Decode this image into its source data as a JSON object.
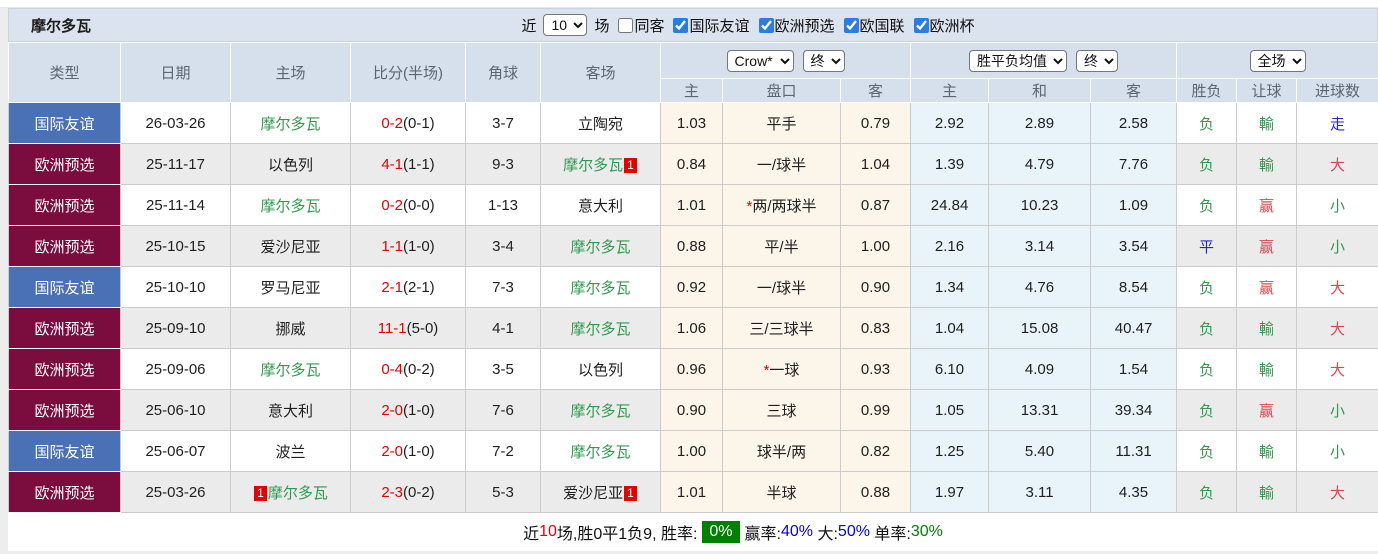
{
  "header": {
    "team": "摩尔多瓦",
    "recent_label": "近",
    "recent_value": "10",
    "matches_label": "场",
    "same_venue": {
      "label": "同客",
      "checked": false
    },
    "filters": [
      {
        "label": "国际友谊",
        "checked": true
      },
      {
        "label": "欧洲预选",
        "checked": true
      },
      {
        "label": "欧国联",
        "checked": true
      },
      {
        "label": "欧洲杯",
        "checked": true
      }
    ]
  },
  "selects": {
    "bookmaker": "Crow*",
    "odds_time": "终",
    "avg_type": "胜平负均值",
    "avg_time": "终",
    "scope": "全场"
  },
  "columns": {
    "left": [
      "类型",
      "日期",
      "主场",
      "比分(半场)",
      "角球",
      "客场"
    ],
    "sub": [
      "主",
      "盘口",
      "客",
      "主",
      "和",
      "客",
      "胜负",
      "让球",
      "进球数"
    ]
  },
  "colors": {
    "friendly_badge": "#4a71b6",
    "qualifier_badge": "#7b0c3e",
    "team_green": "#2f9a4f",
    "score_red": "#e60000",
    "result_red": "#d9474f",
    "result_blue": "#2626d9",
    "rate_badge_bg": "#008000",
    "value_blue": "#0000ee"
  },
  "rows": [
    {
      "type": "国际友谊",
      "type_key": "friendly",
      "date": "26-03-26",
      "home": {
        "name": "摩尔多瓦",
        "green": true,
        "badge_before": "",
        "badge_after": ""
      },
      "score": {
        "ft": "0-2",
        "ht": "(0-1)"
      },
      "corners": "3-7",
      "away": {
        "name": "立陶宛",
        "green": false,
        "badge_before": "",
        "badge_after": ""
      },
      "odds": {
        "home": "1.03",
        "star": false,
        "line": "平手",
        "away": "0.79"
      },
      "avg": {
        "home": "2.92",
        "draw": "2.89",
        "away": "2.58"
      },
      "result": {
        "text": "负",
        "color": "green"
      },
      "handicap": {
        "text": "輸",
        "color": "green"
      },
      "goals": {
        "text": "走",
        "color": "blue"
      }
    },
    {
      "type": "欧洲预选",
      "type_key": "qualifier",
      "date": "25-11-17",
      "home": {
        "name": "以色列",
        "green": false,
        "badge_before": "",
        "badge_after": ""
      },
      "score": {
        "ft": "4-1",
        "ht": "(1-1)"
      },
      "corners": "9-3",
      "away": {
        "name": "摩尔多瓦",
        "green": true,
        "badge_before": "",
        "badge_after": "1"
      },
      "odds": {
        "home": "0.84",
        "star": false,
        "line": "一/球半",
        "away": "1.04"
      },
      "avg": {
        "home": "1.39",
        "draw": "4.79",
        "away": "7.76"
      },
      "result": {
        "text": "负",
        "color": "green"
      },
      "handicap": {
        "text": "輸",
        "color": "green"
      },
      "goals": {
        "text": "大",
        "color": "red"
      }
    },
    {
      "type": "欧洲预选",
      "type_key": "qualifier",
      "date": "25-11-14",
      "home": {
        "name": "摩尔多瓦",
        "green": true,
        "badge_before": "",
        "badge_after": ""
      },
      "score": {
        "ft": "0-2",
        "ht": "(0-0)"
      },
      "corners": "1-13",
      "away": {
        "name": "意大利",
        "green": false,
        "badge_before": "",
        "badge_after": ""
      },
      "odds": {
        "home": "1.01",
        "star": true,
        "line": "两/两球半",
        "away": "0.87"
      },
      "avg": {
        "home": "24.84",
        "draw": "10.23",
        "away": "1.09"
      },
      "result": {
        "text": "负",
        "color": "green"
      },
      "handicap": {
        "text": "赢",
        "color": "red"
      },
      "goals": {
        "text": "小",
        "color": "green"
      }
    },
    {
      "type": "欧洲预选",
      "type_key": "qualifier",
      "date": "25-10-15",
      "home": {
        "name": "爱沙尼亚",
        "green": false,
        "badge_before": "",
        "badge_after": ""
      },
      "score": {
        "ft": "1-1",
        "ht": "(1-0)"
      },
      "corners": "3-4",
      "away": {
        "name": "摩尔多瓦",
        "green": true,
        "badge_before": "",
        "badge_after": ""
      },
      "odds": {
        "home": "0.88",
        "star": false,
        "line": "平/半",
        "away": "1.00"
      },
      "avg": {
        "home": "2.16",
        "draw": "3.14",
        "away": "3.54"
      },
      "result": {
        "text": "平",
        "color": "blue"
      },
      "handicap": {
        "text": "赢",
        "color": "red"
      },
      "goals": {
        "text": "小",
        "color": "green"
      }
    },
    {
      "type": "国际友谊",
      "type_key": "friendly",
      "date": "25-10-10",
      "home": {
        "name": "罗马尼亚",
        "green": false,
        "badge_before": "",
        "badge_after": ""
      },
      "score": {
        "ft": "2-1",
        "ht": "(2-1)"
      },
      "corners": "7-3",
      "away": {
        "name": "摩尔多瓦",
        "green": true,
        "badge_before": "",
        "badge_after": ""
      },
      "odds": {
        "home": "0.92",
        "star": false,
        "line": "一/球半",
        "away": "0.90"
      },
      "avg": {
        "home": "1.34",
        "draw": "4.76",
        "away": "8.54"
      },
      "result": {
        "text": "负",
        "color": "green"
      },
      "handicap": {
        "text": "赢",
        "color": "red"
      },
      "goals": {
        "text": "大",
        "color": "red"
      }
    },
    {
      "type": "欧洲预选",
      "type_key": "qualifier",
      "date": "25-09-10",
      "home": {
        "name": "挪威",
        "green": false,
        "badge_before": "",
        "badge_after": ""
      },
      "score": {
        "ft": "11-1",
        "ht": "(5-0)"
      },
      "corners": "4-1",
      "away": {
        "name": "摩尔多瓦",
        "green": true,
        "badge_before": "",
        "badge_after": ""
      },
      "odds": {
        "home": "1.06",
        "star": false,
        "line": "三/三球半",
        "away": "0.83"
      },
      "avg": {
        "home": "1.04",
        "draw": "15.08",
        "away": "40.47"
      },
      "result": {
        "text": "负",
        "color": "green"
      },
      "handicap": {
        "text": "輸",
        "color": "green"
      },
      "goals": {
        "text": "大",
        "color": "red"
      }
    },
    {
      "type": "欧洲预选",
      "type_key": "qualifier",
      "date": "25-09-06",
      "home": {
        "name": "摩尔多瓦",
        "green": true,
        "badge_before": "",
        "badge_after": ""
      },
      "score": {
        "ft": "0-4",
        "ht": "(0-2)"
      },
      "corners": "3-5",
      "away": {
        "name": "以色列",
        "green": false,
        "badge_before": "",
        "badge_after": ""
      },
      "odds": {
        "home": "0.96",
        "star": true,
        "line": "一球",
        "away": "0.93"
      },
      "avg": {
        "home": "6.10",
        "draw": "4.09",
        "away": "1.54"
      },
      "result": {
        "text": "负",
        "color": "green"
      },
      "handicap": {
        "text": "輸",
        "color": "green"
      },
      "goals": {
        "text": "大",
        "color": "red"
      }
    },
    {
      "type": "欧洲预选",
      "type_key": "qualifier",
      "date": "25-06-10",
      "home": {
        "name": "意大利",
        "green": false,
        "badge_before": "",
        "badge_after": ""
      },
      "score": {
        "ft": "2-0",
        "ht": "(1-0)"
      },
      "corners": "7-6",
      "away": {
        "name": "摩尔多瓦",
        "green": true,
        "badge_before": "",
        "badge_after": ""
      },
      "odds": {
        "home": "0.90",
        "star": false,
        "line": "三球",
        "away": "0.99"
      },
      "avg": {
        "home": "1.05",
        "draw": "13.31",
        "away": "39.34"
      },
      "result": {
        "text": "负",
        "color": "green"
      },
      "handicap": {
        "text": "赢",
        "color": "red"
      },
      "goals": {
        "text": "小",
        "color": "green"
      }
    },
    {
      "type": "国际友谊",
      "type_key": "friendly",
      "date": "25-06-07",
      "home": {
        "name": "波兰",
        "green": false,
        "badge_before": "",
        "badge_after": ""
      },
      "score": {
        "ft": "2-0",
        "ht": "(1-0)"
      },
      "corners": "7-2",
      "away": {
        "name": "摩尔多瓦",
        "green": true,
        "badge_before": "",
        "badge_after": ""
      },
      "odds": {
        "home": "1.00",
        "star": false,
        "line": "球半/两",
        "away": "0.82"
      },
      "avg": {
        "home": "1.25",
        "draw": "5.40",
        "away": "11.31"
      },
      "result": {
        "text": "负",
        "color": "green"
      },
      "handicap": {
        "text": "輸",
        "color": "green"
      },
      "goals": {
        "text": "小",
        "color": "green"
      }
    },
    {
      "type": "欧洲预选",
      "type_key": "qualifier",
      "date": "25-03-26",
      "home": {
        "name": "摩尔多瓦",
        "green": true,
        "badge_before": "1",
        "badge_after": ""
      },
      "score": {
        "ft": "2-3",
        "ht": "(0-2)"
      },
      "corners": "5-3",
      "away": {
        "name": "爱沙尼亚",
        "green": false,
        "badge_before": "",
        "badge_after": "1"
      },
      "odds": {
        "home": "1.01",
        "star": false,
        "line": "半球",
        "away": "0.88"
      },
      "avg": {
        "home": "1.97",
        "draw": "3.11",
        "away": "4.35"
      },
      "result": {
        "text": "负",
        "color": "green"
      },
      "handicap": {
        "text": "輸",
        "color": "green"
      },
      "goals": {
        "text": "大",
        "color": "red"
      }
    }
  ],
  "footer": {
    "prefix": "近",
    "count": "10",
    "mid": "场,胜0平1负9, 胜率:",
    "rate_badge": "0%",
    "win_label": "赢率:",
    "win_value": "40%",
    "big_label": " 大:",
    "big_value": "50%",
    "single_label": " 单率:",
    "single_value": "30%"
  }
}
